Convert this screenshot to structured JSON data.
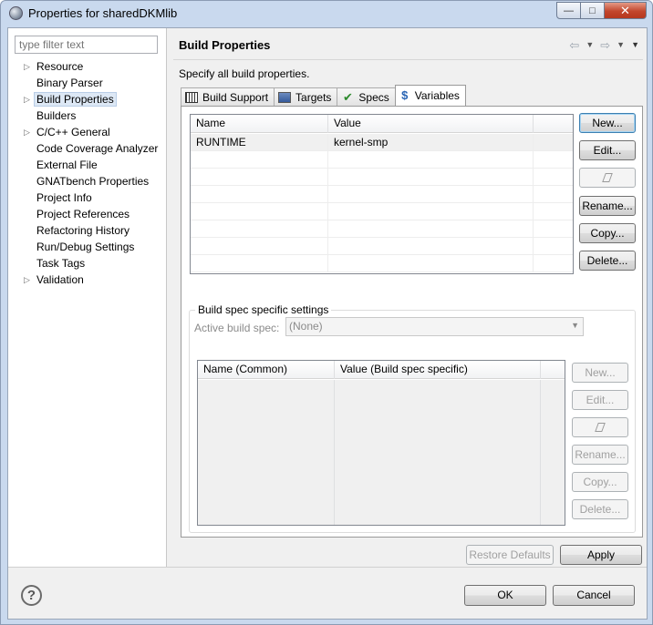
{
  "window": {
    "title": "Properties for sharedDKMlib",
    "controls": {
      "minimize": "—",
      "maximize": "□",
      "close": "✕"
    }
  },
  "filter": {
    "placeholder": "type filter text"
  },
  "tree": {
    "items": [
      {
        "label": "Resource",
        "expandable": true
      },
      {
        "label": "Binary Parser",
        "expandable": false
      },
      {
        "label": "Build Properties",
        "expandable": true,
        "selected": true
      },
      {
        "label": "Builders",
        "expandable": false
      },
      {
        "label": "C/C++ General",
        "expandable": true
      },
      {
        "label": "Code Coverage Analyzer",
        "expandable": false
      },
      {
        "label": "External File",
        "expandable": false
      },
      {
        "label": "GNATbench Properties",
        "expandable": false
      },
      {
        "label": "Project Info",
        "expandable": false
      },
      {
        "label": "Project References",
        "expandable": false
      },
      {
        "label": "Refactoring History",
        "expandable": false
      },
      {
        "label": "Run/Debug Settings",
        "expandable": false
      },
      {
        "label": "Task Tags",
        "expandable": false
      },
      {
        "label": "Validation",
        "expandable": true
      }
    ]
  },
  "header": {
    "title": "Build Properties",
    "description": "Specify all build properties."
  },
  "tabs": [
    {
      "label": "Build Support",
      "icon": "build-support-icon"
    },
    {
      "label": "Targets",
      "icon": "targets-icon"
    },
    {
      "label": "Specs",
      "icon": "specs-icon"
    },
    {
      "label": "Variables",
      "icon": "variables-icon",
      "active": true
    }
  ],
  "variables_table": {
    "columns": [
      "Name",
      "Value"
    ],
    "rows": [
      {
        "name": "RUNTIME",
        "value": "kernel-smp"
      }
    ]
  },
  "variables_buttons": {
    "new": "New...",
    "edit": "Edit...",
    "rename": "Rename...",
    "copy": "Copy...",
    "delete": "Delete..."
  },
  "build_spec": {
    "group_label": "Build spec specific settings",
    "active_label": "Active build spec:",
    "active_value": "(None)",
    "columns": [
      "Name (Common)",
      "Value (Build spec specific)"
    ],
    "buttons": {
      "new": "New...",
      "edit": "Edit...",
      "rename": "Rename...",
      "copy": "Copy...",
      "delete": "Delete..."
    }
  },
  "footer": {
    "restore": "Restore Defaults",
    "apply": "Apply",
    "ok": "OK",
    "cancel": "Cancel"
  }
}
